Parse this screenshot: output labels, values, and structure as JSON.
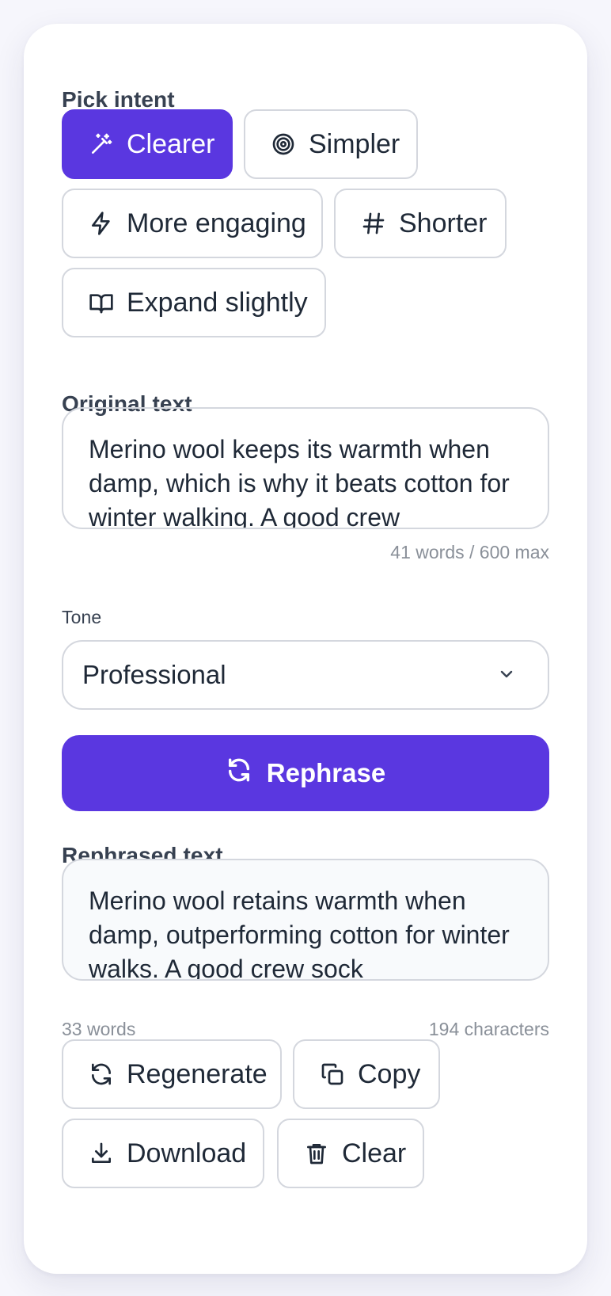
{
  "intent": {
    "label": "Pick intent",
    "options": [
      {
        "label": "Clearer",
        "icon": "magic-wand-icon",
        "selected": true
      },
      {
        "label": "Simpler",
        "icon": "target-icon",
        "selected": false
      },
      {
        "label": "More engaging",
        "icon": "lightning-icon",
        "selected": false
      },
      {
        "label": "Shorter",
        "icon": "hash-icon",
        "selected": false
      },
      {
        "label": "Expand slightly",
        "icon": "book-icon",
        "selected": false
      }
    ]
  },
  "original": {
    "label": "Original text",
    "text": "Merino wool keeps its warmth when damp, which is why it beats cotton for winter walking. A good crew",
    "count": "41 words / 600 max"
  },
  "tone": {
    "label": "Tone",
    "selected": "Professional"
  },
  "rephrase_button": "Rephrase",
  "output": {
    "label": "Rephrased text",
    "text": "Merino wool retains warmth when damp, outperforming cotton for winter walks. A good crew sock",
    "words": "33 words",
    "characters": "194 characters"
  },
  "actions": {
    "regenerate": "Regenerate",
    "copy": "Copy",
    "download": "Download",
    "clear": "Clear"
  },
  "colors": {
    "accent": "#5a37e0",
    "border": "#d4d7de",
    "muted_text": "#8a9099"
  }
}
